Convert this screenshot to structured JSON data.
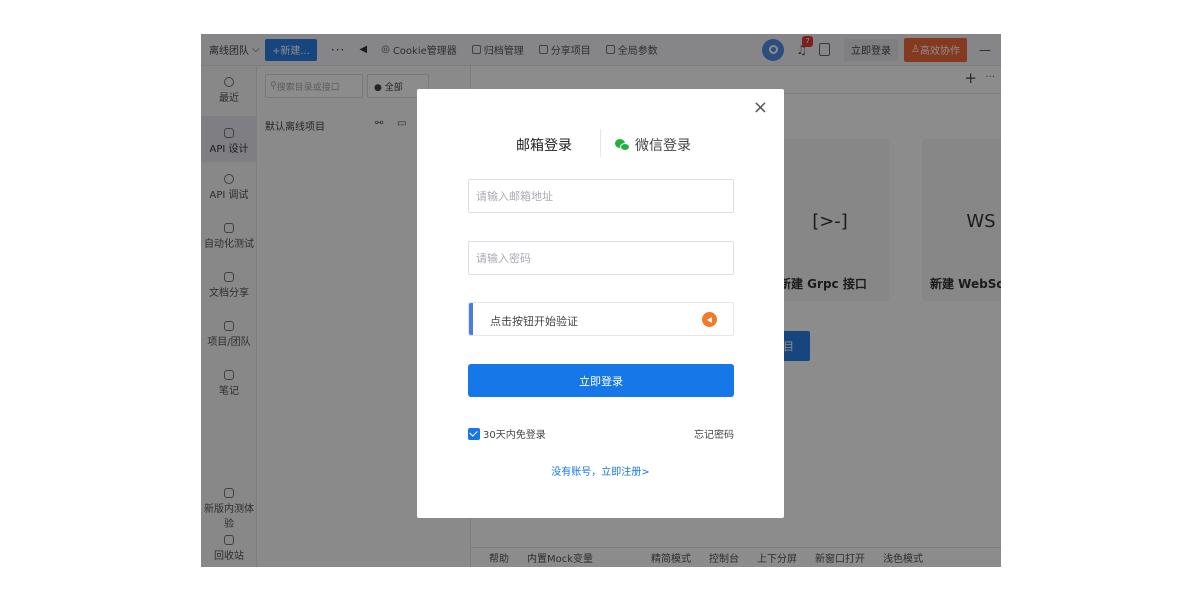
{
  "topbar": {
    "team": "离线团队",
    "new_btn": "+新建...",
    "dots": "···",
    "back": "◀",
    "cookie": "Cookie管理器",
    "archive": "归档管理",
    "share": "分享项目",
    "global_params": "全局参数",
    "notify_count": "7",
    "login": "立即登录",
    "collab": "高效协作",
    "minimize": "—"
  },
  "leftnav": {
    "items": [
      {
        "label": "最近"
      },
      {
        "label": "API 设计"
      },
      {
        "label": "API 调试"
      },
      {
        "label": "自动化测试"
      },
      {
        "label": "文档分享"
      },
      {
        "label": "项目/团队"
      },
      {
        "label": "笔记"
      },
      {
        "label": "新版内测体验"
      },
      {
        "label": "回收站"
      }
    ]
  },
  "tree": {
    "search_placeholder": "搜索目录或接口",
    "filter": "● 全部",
    "root_item": "默认离线项目"
  },
  "main": {
    "plus": "+",
    "more": "···",
    "cards": [
      {
        "icon": "[>-]",
        "label": "新建 Grpc 接口"
      },
      {
        "icon": "WS",
        "label": "新建 WebSoc"
      }
    ],
    "blue_block": "目"
  },
  "bottombar": {
    "items": [
      "帮助",
      "内置Mock变量",
      "精简模式",
      "控制台",
      "上下分屏",
      "新窗口打开",
      "浅色模式"
    ]
  },
  "modal": {
    "close": "×",
    "tab_email": "邮箱登录",
    "tab_wechat": "微信登录",
    "email_placeholder": "请输入邮箱地址",
    "password_placeholder": "请输入密码",
    "captcha": "点击按钮开始验证",
    "submit": "立即登录",
    "remember": "30天内免登录",
    "forgot": "忘记密码",
    "register": "没有账号，立即注册>"
  },
  "colors": {
    "primary": "#1677e8",
    "collab": "#f26b3a",
    "wechat": "#20b33c",
    "captcha_icon": "#f07a28"
  }
}
